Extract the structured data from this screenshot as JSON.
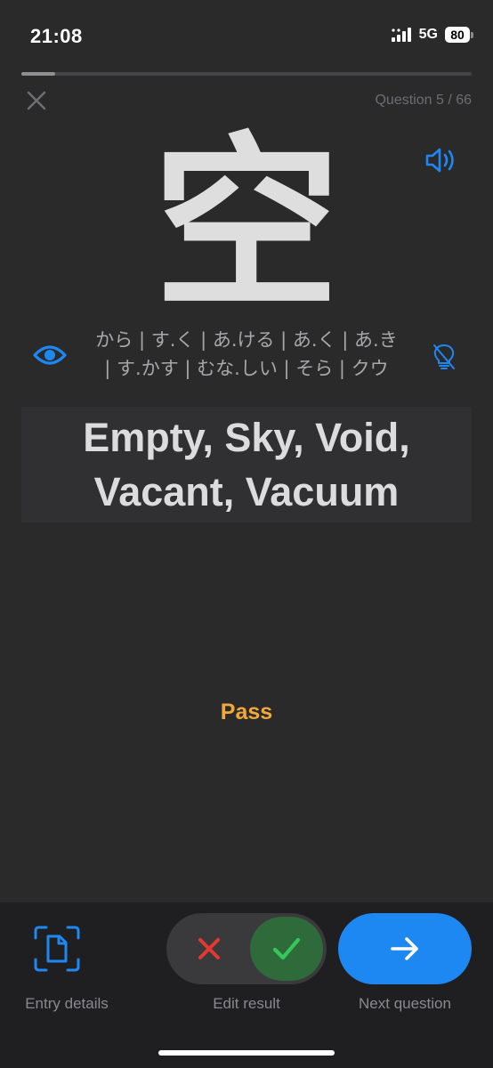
{
  "status_bar": {
    "time": "21:08",
    "network": "5G",
    "battery": "80"
  },
  "quiz": {
    "progress_fraction": 0.075,
    "question_label": "Question 5 / 66",
    "kanji": "空",
    "readings_line1": "から | す.く | あ.ける | あ.く | あ.き",
    "readings_line2": "| す.かす | むな.しい | そら | クウ",
    "meaning_line1": "Empty, Sky, Void,",
    "meaning_line2": "Vacant, Vacuum",
    "result": "Pass"
  },
  "bottom_bar": {
    "entry_details_label": "Entry details",
    "edit_result_label": "Edit result",
    "next_question_label": "Next question"
  },
  "icons": {
    "close": "close-icon",
    "speaker": "speaker-icon",
    "eye": "eye-icon",
    "hint_off": "lightbulb-off-icon",
    "entry_details": "document-scan-icon",
    "wrong": "x-mark-icon",
    "correct": "checkmark-icon",
    "next": "arrow-right-icon"
  },
  "colors": {
    "accent_blue": "#1e88f2",
    "pass_orange": "#f0a93a",
    "wrong_red": "#e5392f",
    "correct_green": "#34c759",
    "correct_bg": "#2f6a3a"
  }
}
